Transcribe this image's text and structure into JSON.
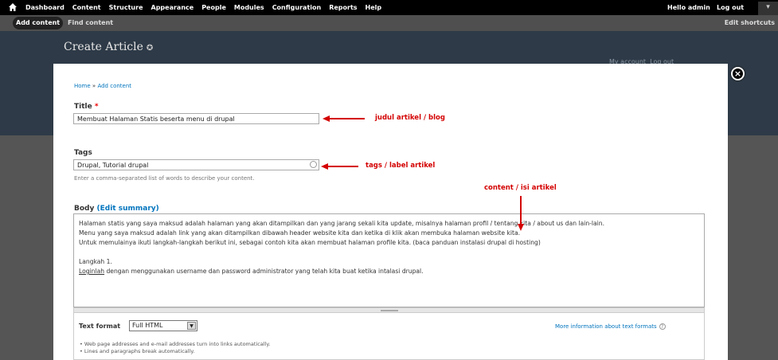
{
  "toolbar": {
    "home_icon": "home-icon",
    "menu": [
      "Dashboard",
      "Content",
      "Structure",
      "Appearance",
      "People",
      "Modules",
      "Configuration",
      "Reports",
      "Help"
    ],
    "hello_prefix": "Hello",
    "username": "admin",
    "logout": "Log out",
    "toggle": "▾"
  },
  "shortcuts": {
    "add": "Add content",
    "find": "Find content",
    "edit": "Edit shortcuts"
  },
  "header": {
    "title": "Create Article",
    "star": "✪",
    "my_account": "My account",
    "log_out": "Log out"
  },
  "overlay": {
    "close": "×",
    "breadcrumb_home": "Home",
    "breadcrumb_sep": "»",
    "breadcrumb_add": "Add content"
  },
  "form": {
    "title_label": "Title",
    "required_mark": "*",
    "title_value": "Membuat Halaman Statis beserta menu di drupal",
    "tags_label": "Tags",
    "tags_value": "Drupal, Tutorial drupal",
    "tags_desc": "Enter a comma-separated list of words to describe your content.",
    "body_label": "Body",
    "body_edit_open": "(",
    "body_edit_summary": "Edit summary",
    "body_edit_close": ")",
    "body_lines": [
      "Halaman statis yang saya maksud adalah halaman yang akan ditampilkan dan yang jarang sekali kita update, misalnya halaman profil / tentang kita / about us dan lain-lain.",
      "Menu yang saya maksud adalah link yang akan ditampilkan dibawah header website kita dan ketika di klik akan membuka halaman website kita.",
      "Untuk memulainya ikuti langkah-langkah berikut ini, sebagai contoh kita akan membuat halaman profile kita. (baca panduan instalasi drupal di hosting)",
      "",
      "Langkah 1.",
      "Loginlah",
      " dengan menggunakan username dan password administrator yang telah kita buat ketika intalasi drupal."
    ],
    "text_format_label": "Text format",
    "text_format_value": "Full HTML",
    "more_info": "More information about text formats",
    "help_icon": "?",
    "tips": [
      "Web page addresses and e-mail addresses turn into links automatically.",
      "Lines and paragraphs break automatically."
    ]
  },
  "annotations": {
    "title": "judul artikel / blog",
    "tags": "tags / label artikel",
    "content": "content / isi artikel"
  },
  "colors": {
    "annotation": "#d40000",
    "link": "#0074bd",
    "header_bg": "#2e3a47"
  }
}
